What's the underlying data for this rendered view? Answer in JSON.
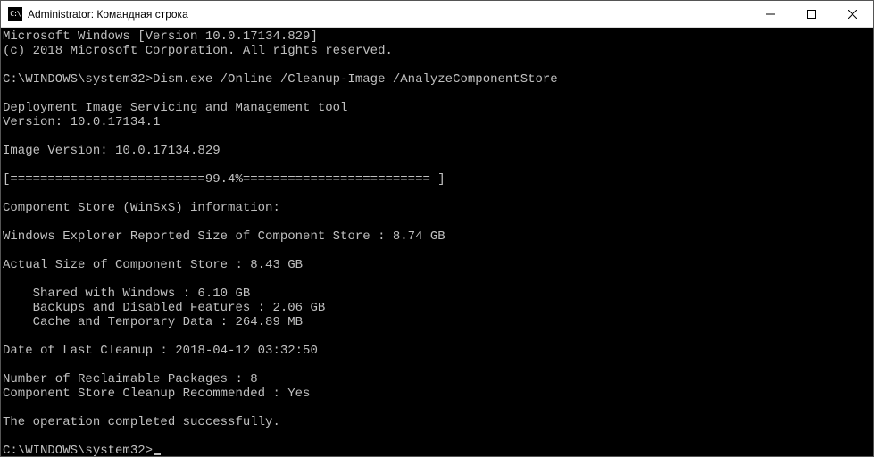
{
  "window": {
    "title": "Administrator: Командная строка",
    "icon_label": "C:\\"
  },
  "terminal": {
    "banner_line1": "Microsoft Windows [Version 10.0.17134.829]",
    "banner_line2": "(c) 2018 Microsoft Corporation. All rights reserved.",
    "prompt1": "C:\\WINDOWS\\system32>",
    "command1": "Dism.exe /Online /Cleanup-Image /AnalyzeComponentStore",
    "dism_tool_line": "Deployment Image Servicing and Management tool",
    "dism_version_line": "Version: 10.0.17134.1",
    "image_version_line": "Image Version: 10.0.17134.829",
    "progress_line": "[==========================99.4%========================= ]",
    "component_info_heading": "Component Store (WinSxS) information:",
    "explorer_reported_line": "Windows Explorer Reported Size of Component Store : 8.74 GB",
    "actual_size_line": "Actual Size of Component Store : 8.43 GB",
    "shared_line": "    Shared with Windows : 6.10 GB",
    "backups_line": "    Backups and Disabled Features : 2.06 GB",
    "cache_line": "    Cache and Temporary Data : 264.89 MB",
    "last_cleanup_line": "Date of Last Cleanup : 2018-04-12 03:32:50",
    "reclaimable_line": "Number of Reclaimable Packages : 8",
    "cleanup_recommended_line": "Component Store Cleanup Recommended : Yes",
    "success_line": "The operation completed successfully.",
    "prompt2": "C:\\WINDOWS\\system32>"
  }
}
